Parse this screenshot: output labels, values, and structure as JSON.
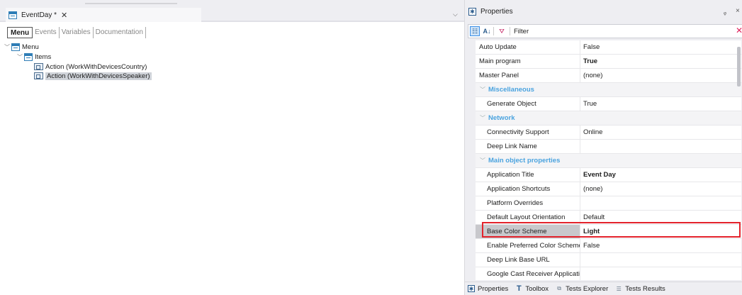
{
  "document_tab": {
    "title": "EventDay *",
    "close_glyph": "✕",
    "dropdown_glyph": "⌵"
  },
  "part_tabs": [
    {
      "label": "Menu",
      "active": true
    },
    {
      "label": "Events",
      "active": false
    },
    {
      "label": "Variables",
      "active": false
    },
    {
      "label": "Documentation",
      "active": false
    }
  ],
  "tree": {
    "root": "Menu",
    "items": "Items",
    "actions": [
      "Action (WorkWithDevicesCountry)",
      "Action (WorkWithDevicesSpeaker)"
    ]
  },
  "properties_panel": {
    "title": "Properties",
    "pin_glyph": "ᵩ",
    "close_glyph": "×",
    "filter_label": "Filter",
    "rows": [
      {
        "type": "prop",
        "name": "Auto Update",
        "value": "False",
        "bold": false
      },
      {
        "type": "prop",
        "name": "Main program",
        "value": "True",
        "bold": true
      },
      {
        "type": "prop",
        "name": "Master Panel",
        "value": "(none)",
        "bold": false
      },
      {
        "type": "category",
        "name": "Miscellaneous"
      },
      {
        "type": "prop",
        "name": "Generate Object",
        "value": "True",
        "bold": false,
        "indent": true
      },
      {
        "type": "category",
        "name": "Network"
      },
      {
        "type": "prop",
        "name": "Connectivity Support",
        "value": "Online",
        "bold": false,
        "indent": true
      },
      {
        "type": "prop",
        "name": "Deep Link Name",
        "value": "",
        "bold": false,
        "indent": true
      },
      {
        "type": "category",
        "name": "Main object properties"
      },
      {
        "type": "prop",
        "name": "Application Title",
        "value": "Event Day",
        "bold": true,
        "indent": true
      },
      {
        "type": "prop",
        "name": "Application Shortcuts",
        "value": "(none)",
        "bold": false,
        "indent": true
      },
      {
        "type": "prop",
        "name": "Platform Overrides",
        "value": "",
        "bold": false,
        "indent": true
      },
      {
        "type": "prop",
        "name": "Default Layout Orientation",
        "value": "Default",
        "bold": false,
        "indent": true
      },
      {
        "type": "prop",
        "name": "Base Color Scheme",
        "value": "Light",
        "bold": true,
        "indent": true,
        "selected": true
      },
      {
        "type": "prop",
        "name": "Enable Preferred Color Scheme",
        "value": "False",
        "bold": false,
        "indent": true
      },
      {
        "type": "prop",
        "name": "Deep Link Base URL",
        "value": "",
        "bold": false,
        "indent": true
      },
      {
        "type": "prop",
        "name": "Google Cast Receiver Applicatic",
        "value": "",
        "bold": false,
        "indent": true
      }
    ],
    "bottom_tabs": [
      {
        "label": "Properties",
        "icon": "gear-icon"
      },
      {
        "label": "Toolbox",
        "icon": "toolbox-icon"
      },
      {
        "label": "Tests Explorer",
        "icon": "tests-explorer-icon"
      },
      {
        "label": "Tests Results",
        "icon": "tests-results-icon"
      }
    ]
  },
  "colors": {
    "accent_blue": "#2e7db6",
    "category_text": "#4aa3df",
    "highlight_red": "#e3232c",
    "selected_row": "#c8c8cc"
  }
}
